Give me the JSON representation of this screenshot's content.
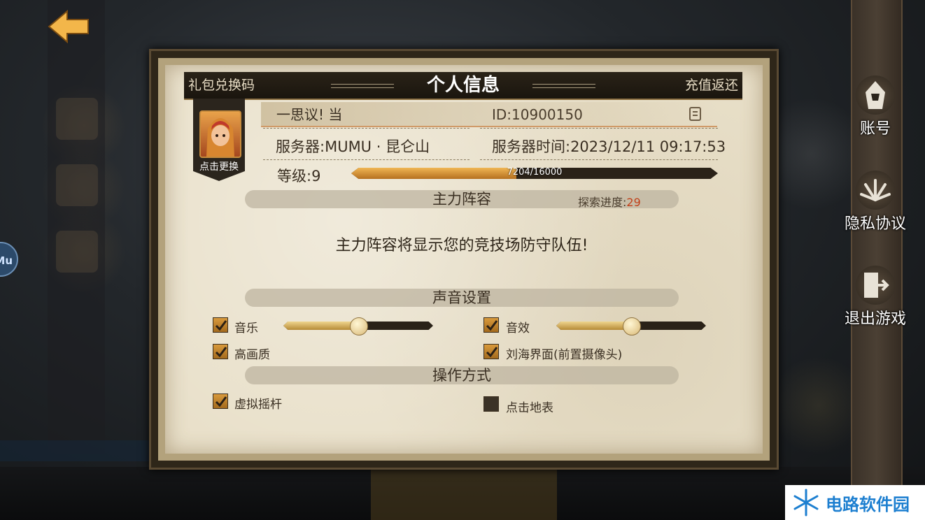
{
  "background": {
    "top_text": "",
    "bottom_tabs": []
  },
  "dialog": {
    "title": "个人信息",
    "gift_code": "礼包兑换码",
    "recharge": "充值返还",
    "avatar_label": "点击更换",
    "player_name": "一思议! 当",
    "player_id": "ID:10900150",
    "server": "服务器:MUMU · 昆仑山",
    "server_time": "服务器时间:2023/12/11 09:17:53",
    "level": "等级:9",
    "xp": {
      "text": "7204/16000",
      "current": 7204,
      "max": 16000
    },
    "main_lineup": {
      "title": "主力阵容",
      "explore_label": "探索进度:",
      "explore_value": "29",
      "notice": "主力阵容将显示您的竞技场防守队伍!"
    },
    "sound": {
      "title": "声音设置",
      "music": {
        "label": "音乐",
        "checked": true,
        "level": 0.5
      },
      "effects": {
        "label": "音效",
        "checked": true,
        "level": 0.5
      },
      "high_quality": {
        "label": "高画质",
        "checked": true
      },
      "notch": {
        "label": "刘海界面(前置摄像头)",
        "checked": true
      }
    },
    "controls": {
      "title": "操作方式",
      "joystick": {
        "label": "虚拟摇杆",
        "checked": true
      },
      "tap_ground": {
        "label": "点击地表",
        "checked": false
      }
    }
  },
  "right_menu": {
    "account": "账号",
    "privacy": "隐私协议",
    "exit": "退出游戏"
  },
  "left_badge": "Mu",
  "watermark": "电路软件园",
  "colors": {
    "accent": "#d99a3c",
    "parchment": "#e8dfc8",
    "explore_value": "#c2411a"
  }
}
